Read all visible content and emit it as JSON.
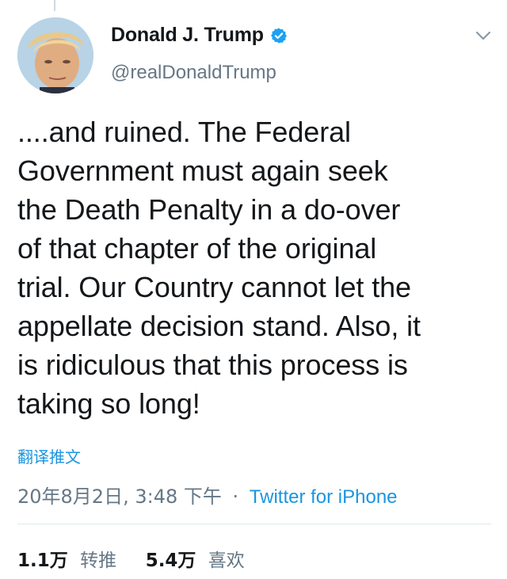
{
  "header": {
    "display_name": "Donald J. Trump",
    "handle": "@realDonaldTrump"
  },
  "tweet": {
    "lines": [
      "....and ruined. The Federal",
      "Government must again seek",
      "the Death Penalty in a do-over",
      "of that chapter of the original",
      "trial. Our Country cannot let the",
      "appellate decision stand. Also, it",
      "is ridiculous that this process is",
      "taking so long!"
    ],
    "translate_label": "翻译推文"
  },
  "meta": {
    "timestamp": "20年8月2日, 3:48 下午",
    "separator": "·",
    "source": "Twitter for iPhone"
  },
  "stats": {
    "retweets_count": "1.1万",
    "retweets_label": "转推",
    "likes_count": "5.4万",
    "likes_label": "喜欢"
  },
  "icons": {
    "verified": "verified-badge-icon",
    "caret": "chevron-down-icon"
  },
  "colors": {
    "accent": "#1b95e0",
    "secondary_text": "#657786",
    "primary_text": "#14171a",
    "verified": "#1da1f2"
  }
}
